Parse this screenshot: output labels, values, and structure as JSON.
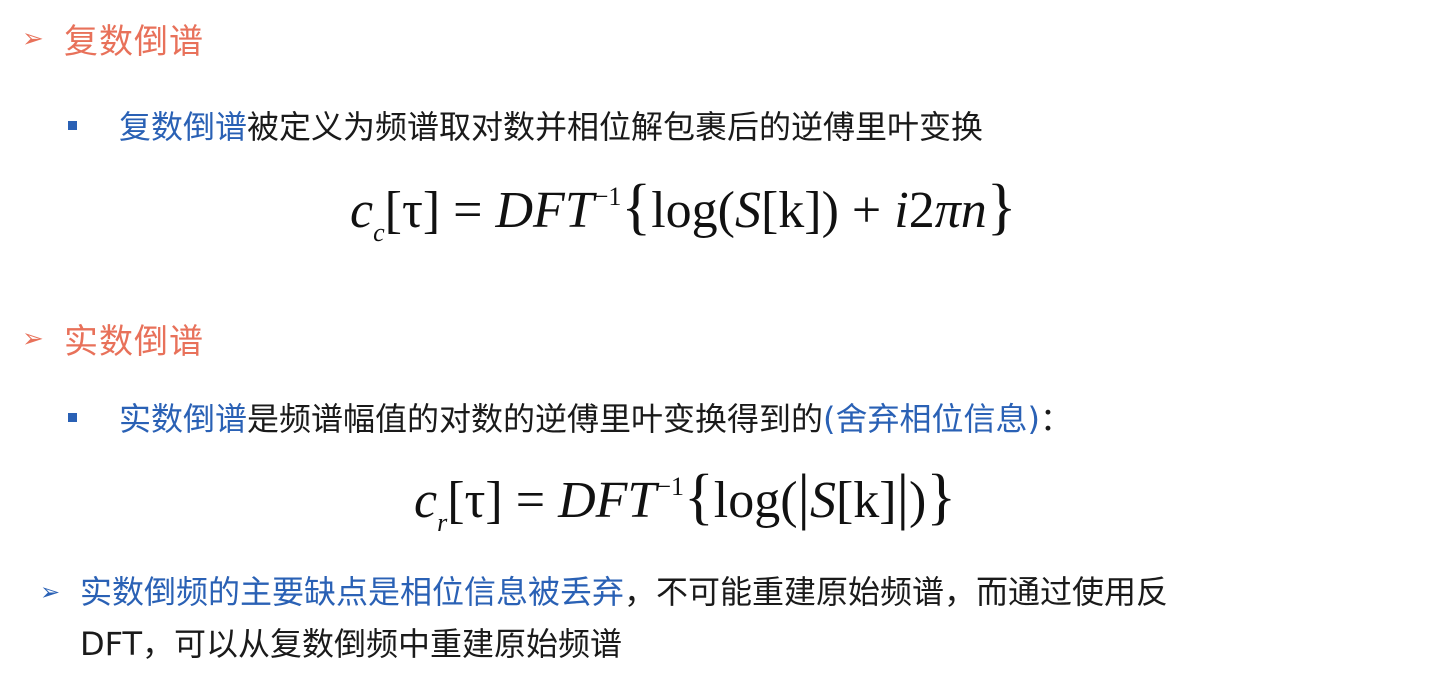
{
  "section1": {
    "title": "复数倒谱",
    "bullet_term": "复数倒谱",
    "bullet_rest": "被定义为频谱取对数并相位解包裹后的逆傅里叶变换",
    "formula": {
      "lhs": "c",
      "lhs_sub": "c",
      "tau": "[τ] = ",
      "op": "DFT",
      "sup": "−1",
      "open": "{",
      "body": "log(",
      "s": "S",
      "k": "[k]",
      "tail": ") + ",
      "i2": "i",
      "two": "2",
      "pin": "πn",
      "close": "}"
    }
  },
  "section2": {
    "title": "实数倒谱",
    "bullet_term": "实数倒谱",
    "bullet_rest": "是频谱幅值的对数的逆傅里叶变换得到的",
    "bullet_paren": "(舍弃相位信息)",
    "bullet_end": "：",
    "formula": {
      "lhs": "c",
      "lhs_sub": "r",
      "tau": "[τ] = ",
      "op": "DFT",
      "sup": "−1",
      "open": "{",
      "body": "log(",
      "bar_open": "|",
      "s": "S",
      "k": "[k]",
      "bar_close": "|",
      "tail": ")",
      "close": "}"
    }
  },
  "note": {
    "blue_part": "实数倒频的主要缺点是相位信息被丢弃",
    "rest_line1": "，不可能重建原始频谱，而通过使用反",
    "line2": "DFT，可以从复数倒频中重建原始频谱"
  },
  "colors": {
    "header": "#e8715a",
    "accent_blue": "#2a61b5",
    "text": "#1a1a1a"
  },
  "icons": {
    "section_marker": "arrowhead-right-icon",
    "bullet_marker": "square-bullet-icon"
  }
}
